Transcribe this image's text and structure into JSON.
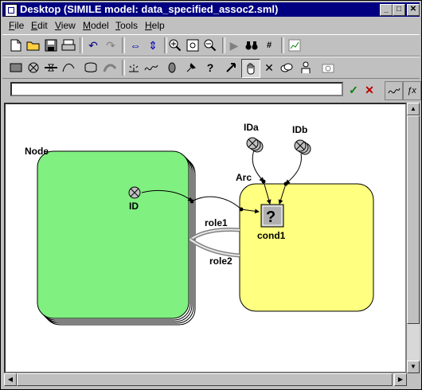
{
  "window": {
    "title": "Desktop (SIMILE model: data_specified_assoc2.sml)"
  },
  "title_buttons": {
    "minimize": "_",
    "maximize": "□",
    "close": "✕"
  },
  "menu": [
    {
      "label": "File"
    },
    {
      "label": "Edit"
    },
    {
      "label": "View"
    },
    {
      "label": "Model"
    },
    {
      "label": "Tools"
    },
    {
      "label": "Help"
    }
  ],
  "toolbar1_icons": [
    "new-file-icon",
    "open-folder-icon",
    "save-icon",
    "print-icon",
    "undo-icon",
    "redo-icon",
    "move-horizontal-icon",
    "move-vertical-icon",
    "zoom-in-icon",
    "zoom-fit-icon",
    "zoom-out-icon",
    "run-icon",
    "binoculars-icon",
    "find-next-icon",
    "chart-icon"
  ],
  "toolbar2_icons": [
    "compartment-icon",
    "variable-icon",
    "flow-icon",
    "influence-icon",
    "submodel-icon",
    "role-arrow-icon",
    "event-icon",
    "squiggle-icon",
    "oval-icon",
    "pin-icon",
    "help-question-icon",
    "arrow-pointer-icon",
    "hand-icon",
    "delete-icon",
    "duplicate-icon",
    "puppet-icon",
    "snapshot-icon"
  ],
  "formula": {
    "value": "",
    "accept": "✓",
    "reject": "✕"
  },
  "diagram": {
    "node_label": "Node",
    "arc_label": "Arc",
    "id_label": "ID",
    "ida_label": "IDa",
    "idb_label": "IDb",
    "cond_label": "cond1",
    "cond_symbol": "?",
    "role1_label": "role1",
    "role2_label": "role2",
    "node_color": "#80f080",
    "arc_color": "#ffff80"
  }
}
